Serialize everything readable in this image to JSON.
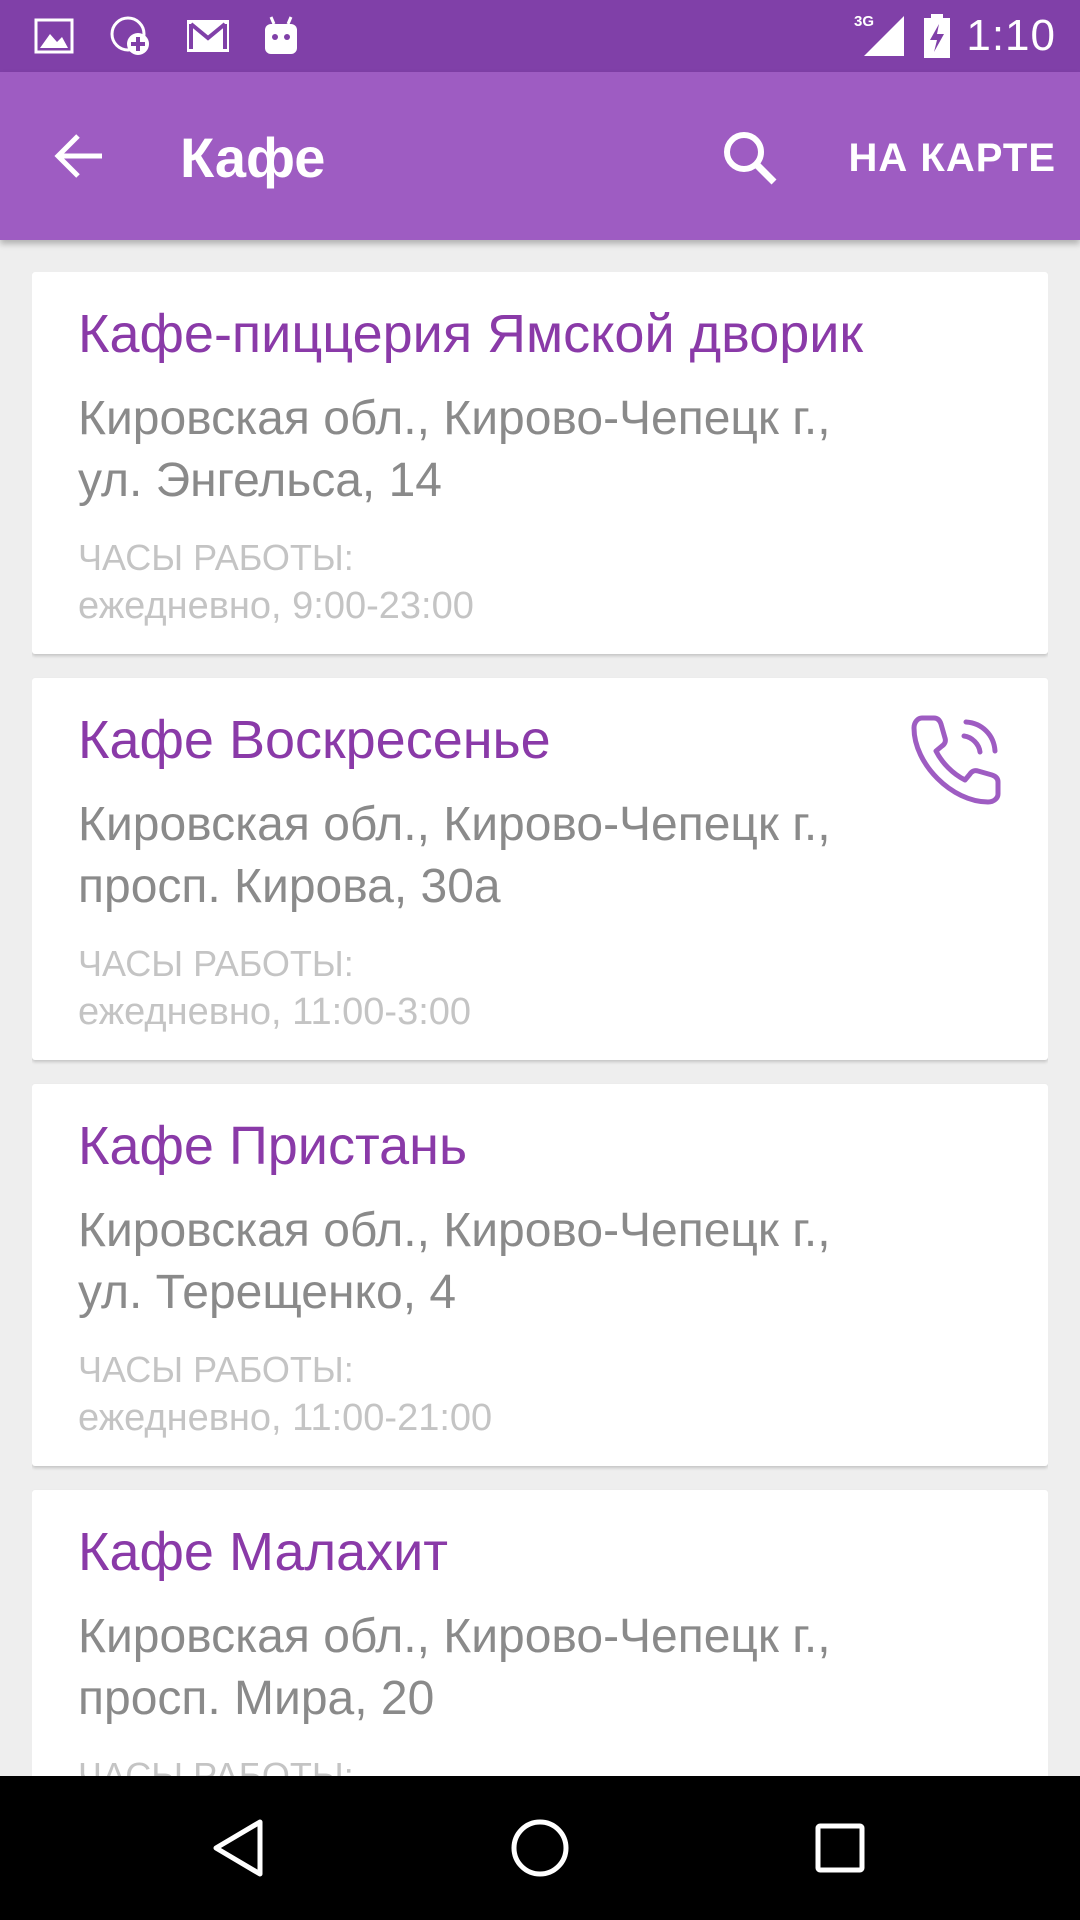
{
  "status_bar": {
    "network": "3G",
    "time": "1:10",
    "icons": [
      "image-icon",
      "whatsapp-icon",
      "gmail-icon",
      "android-icon",
      "signal-icon",
      "battery-charging-icon"
    ]
  },
  "app_bar": {
    "title": "Кафе",
    "map_button_label": "НА КАРТЕ",
    "back_icon": "arrow-back-icon",
    "search_icon": "search-icon"
  },
  "cafes": [
    {
      "name": "Кафе-пиццерия Ямской дворик",
      "address_line1": "Кировская обл., Кирово-Чепецк г.,",
      "address_line2": "ул. Энгельса, 14",
      "hours_label": "ЧАСЫ РАБОТЫ:",
      "hours": "ежедневно, 9:00-23:00",
      "has_phone": false
    },
    {
      "name": "Кафе Воскресенье",
      "address_line1": "Кировская обл., Кирово-Чепецк г.,",
      "address_line2": "просп. Кирова, 30а",
      "hours_label": "ЧАСЫ РАБОТЫ:",
      "hours": "ежедневно, 11:00-3:00",
      "has_phone": true
    },
    {
      "name": "Кафе Пристань",
      "address_line1": "Кировская обл., Кирово-Чепецк г.,",
      "address_line2": "ул. Терещенко, 4",
      "hours_label": "ЧАСЫ РАБОТЫ:",
      "hours": "ежедневно, 11:00-21:00",
      "has_phone": false
    },
    {
      "name": "Кафе Малахит",
      "address_line1": "Кировская обл., Кирово-Чепецк г.,",
      "address_line2": "просп. Мира, 20",
      "hours_label": "ЧАСЫ РАБОТЫ:",
      "hours": "",
      "has_phone": false
    }
  ],
  "colors": {
    "status_bar": "#8040a8",
    "app_bar": "#9e5cc2",
    "accent": "#8a3aa8",
    "address_text": "#8a8a8a",
    "hours_text": "#c4c4c4"
  },
  "nav_bar": {
    "icons": [
      "back-triangle-icon",
      "home-circle-icon",
      "recents-square-icon"
    ]
  }
}
